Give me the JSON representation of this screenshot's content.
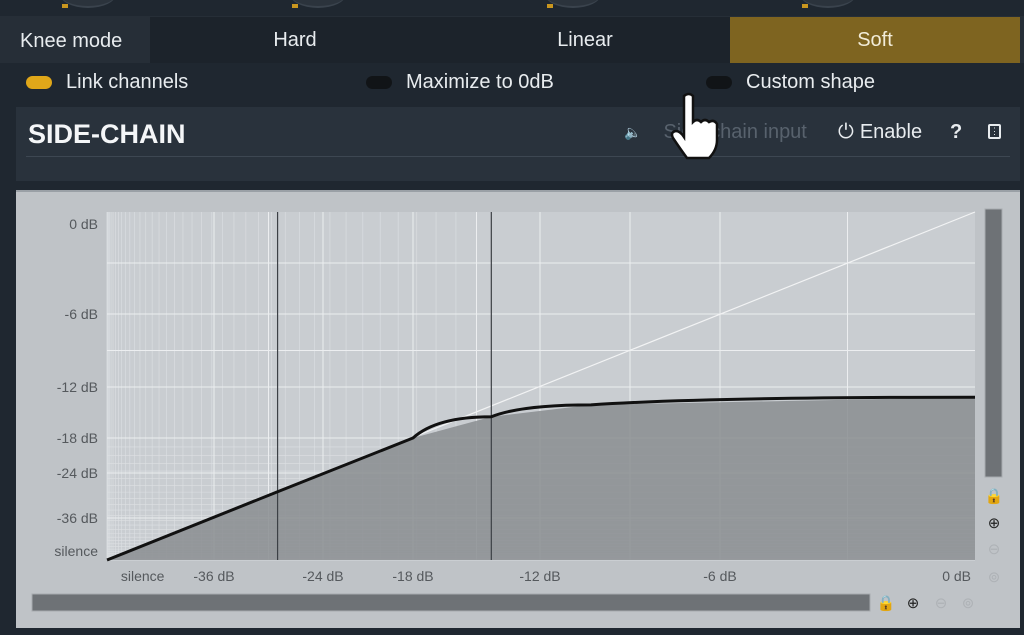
{
  "knee": {
    "label": "Knee mode",
    "options": [
      "Hard",
      "Linear",
      "Soft"
    ],
    "selected": "Soft"
  },
  "options": [
    {
      "label": "Link channels",
      "on": true
    },
    {
      "label": "Maximize to 0dB",
      "on": false
    },
    {
      "label": "Custom shape",
      "on": false
    }
  ],
  "sidechain": {
    "title": "SIDE-CHAIN",
    "input_label": "Side-chain input",
    "enable_label": "Enable",
    "help_label": "?"
  },
  "colors": {
    "accent": "#e0a719",
    "selected_segment": "#7e6420",
    "curve": "#111111"
  },
  "chart_data": {
    "type": "line",
    "x_ticks": [
      "silence",
      "-36 dB",
      "-24 dB",
      "-18 dB",
      "-12 dB",
      "-6 dB",
      "0 dB"
    ],
    "y_ticks": [
      "0 dB",
      "-6 dB",
      "-12 dB",
      "-18 dB",
      "-24 dB",
      "-36 dB",
      "silence"
    ],
    "xlim": [
      "silence",
      0
    ],
    "ylim": [
      "silence",
      0
    ],
    "grid": true,
    "reference_line": "1:1 diagonal",
    "markers_x": [
      -29,
      -14.3
    ],
    "curve": [
      [
        "silence",
        "silence"
      ],
      [
        -29,
        -29
      ],
      [
        -18,
        -18
      ],
      [
        -14.3,
        -15.5
      ],
      [
        -10.3,
        -14.1
      ],
      [
        0,
        -13.2
      ]
    ]
  }
}
